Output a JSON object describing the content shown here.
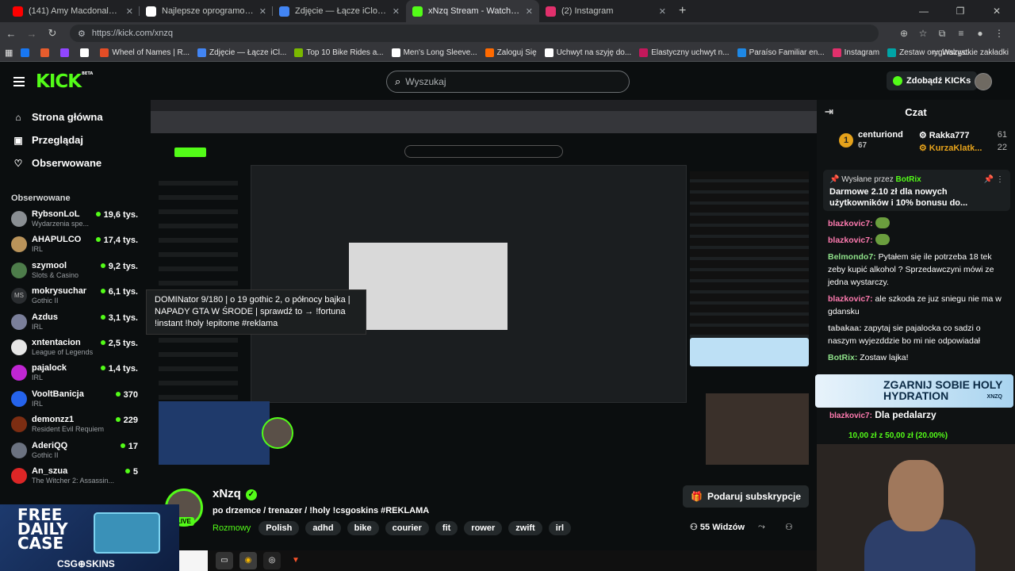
{
  "browser": {
    "tabs": [
      {
        "title": "(141) Amy Macdonald - Th",
        "icon_color": "#ff0000",
        "icon": "youtube-icon",
        "active": false
      },
      {
        "title": "Najlepsze oprogramowanie do",
        "icon_color": "#ffffff",
        "icon": "shield-icon",
        "active": false
      },
      {
        "title": "Zdjęcie — Łącze iCloud — Zdj",
        "icon_color": "#4285f4",
        "icon": "photos-icon",
        "active": false
      },
      {
        "title": "xNzq Stream - Watch Live on K",
        "icon_color": "#53fc18",
        "icon": "kick-icon",
        "active": true
      },
      {
        "title": "(2) Instagram",
        "icon_color": "#e1306c",
        "icon": "instagram-icon",
        "active": false
      }
    ],
    "url": "https://kick.com/xnzq",
    "bookmarks": [
      {
        "label": "",
        "color": "#1877f2"
      },
      {
        "label": "",
        "color": "#e65c2d"
      },
      {
        "label": "",
        "color": "#9146ff"
      },
      {
        "label": "",
        "color": "#ffffff"
      },
      {
        "label": "Wheel of Names | R...",
        "color": "#e44d26"
      },
      {
        "label": "Zdjęcie — Łącze iCl...",
        "color": "#4285f4"
      },
      {
        "label": "Top 10 Bike Rides a...",
        "color": "#7ab800"
      },
      {
        "label": "Men's Long Sleeve...",
        "color": "#ffffff"
      },
      {
        "label": "Zaloguj Się",
        "color": "#ff6a00"
      },
      {
        "label": "Uchwyt na szyję do...",
        "color": "#ffffff"
      },
      {
        "label": "Elastyczny uchwyt n...",
        "color": "#c2185b"
      },
      {
        "label": "Paraíso Familiar en...",
        "color": "#1e88e5"
      },
      {
        "label": "Instagram",
        "color": "#e1306c"
      },
      {
        "label": "Zestaw oryginalnyc...",
        "color": "#00a4a6"
      }
    ],
    "all_bookmarks": "Wszystkie zakładki"
  },
  "header": {
    "logo": "KICK",
    "logo_badge": "BETA",
    "search_placeholder": "Wyszukaj",
    "get_kicks": "Zdobądź KICKs"
  },
  "sidebar": {
    "nav": [
      {
        "label": "Strona główna",
        "icon": "home-icon"
      },
      {
        "label": "Przeglądaj",
        "icon": "browse-icon"
      },
      {
        "label": "Obserwowane",
        "icon": "heart-icon"
      }
    ],
    "following_title": "Obserwowane",
    "channels": [
      {
        "name": "RybsonLoL",
        "game": "Wydarzenia spe...",
        "viewers": "19,6 tys.",
        "color": "#8a8f93"
      },
      {
        "name": "AHAPULCO",
        "game": "IRL",
        "viewers": "17,4 tys.",
        "color": "#b9935a"
      },
      {
        "name": "szymool",
        "game": "Slots & Casino",
        "viewers": "9,2 tys.",
        "color": "#4d7c4a"
      },
      {
        "name": "mokrysuchar",
        "game": "Gothic II",
        "viewers": "6,1 tys.",
        "color": "#2a2d30"
      },
      {
        "name": "Azdus",
        "game": "IRL",
        "viewers": "3,1 tys.",
        "color": "#7a7f9a"
      },
      {
        "name": "xntentacion",
        "game": "League of Legends",
        "viewers": "2,5 tys.",
        "color": "#e6e6e6"
      },
      {
        "name": "pajalock",
        "game": "IRL",
        "viewers": "1,4 tys.",
        "color": "#c026d3"
      },
      {
        "name": "VooltBanicja",
        "game": "IRL",
        "viewers": "370",
        "color": "#2563eb"
      },
      {
        "name": "demonzz1",
        "game": "Resident Evil Requiem",
        "viewers": "229",
        "color": "#7c2d12"
      },
      {
        "name": "AderiQQ",
        "game": "Gothic II",
        "viewers": "17",
        "color": "#6b7280"
      },
      {
        "name": "An_szua",
        "game": "The Witcher 2: Assassin...",
        "viewers": "5",
        "color": "#dc2626"
      }
    ],
    "avatar_initials": "MS",
    "tooltip": "DOMINator 9/180 | o 19 gothic 2, o północy bajka | NAPADY GTA W ŚRODE | sprawdź to → !fortuna !instant !holy !epitome #reklama"
  },
  "ad": {
    "line1": "FREE",
    "line2": "DAILY",
    "line3": "CASE",
    "brand": "CSG⊕SKINS"
  },
  "stream": {
    "channel": "xNzq",
    "title": "po drzemce / trenazer / !holy !csgoskins #REKLAMA",
    "category": "Rozmowy",
    "tags": [
      "Polish",
      "adhd",
      "bike",
      "courier",
      "fit",
      "rower",
      "zwift",
      "irl"
    ],
    "subscribe": "Podaruj subskrypcje",
    "viewers": "55",
    "viewers_label": "Widzów",
    "live": "LIVE"
  },
  "chat": {
    "title": "Czat",
    "leaderboard": [
      {
        "rank": "1",
        "name": "centuriond",
        "value": "67"
      },
      {
        "name": "Rakka777",
        "value": "61"
      },
      {
        "name": "KurzaKlatk...",
        "value": "22"
      }
    ],
    "pinned_by_label": "Wysłane przez",
    "pinned_by": "BotRix",
    "pinned_message": "Darmowe 2.10 zł dla nowych użytkowników i 10% bonusu do...",
    "messages": [
      {
        "user": "blazkovic7:",
        "text": "",
        "cls": "pink",
        "emote": true
      },
      {
        "user": "blazkovic7:",
        "text": "",
        "cls": "pink",
        "emote": true
      },
      {
        "user": "Belmondo7:",
        "text": " Pytałem się ile potrzeba 18 tek zeby kupić alkohol ? Sprzedawczyni mówi ze jedna wystarczy.",
        "cls": "green",
        "emote": false
      },
      {
        "user": "blazkovic7:",
        "text": " ale szkoda ze juz sniegu nie ma w gdansku",
        "cls": "pink",
        "emote": false
      },
      {
        "user": "tabakaa:",
        "text": " zapytaj sie pajalocka co sadzi o naszym wyjezddzie bo mi nie odpowiadał",
        "cls": "gray",
        "emote": false
      },
      {
        "user": "BotRix:",
        "text": " Zostaw lajka!",
        "cls": "green",
        "emote": false
      },
      {
        "user": "blazkovic7:",
        "text": " Dla pedalarzy",
        "cls": "pink",
        "emote": false
      }
    ],
    "holy_text": "ZGARNIJ SOBIE HOLY HYDRATION",
    "holy_brand": "XNZQ",
    "promo": "10,00 zł z 50,00 zł (20.00%)"
  }
}
